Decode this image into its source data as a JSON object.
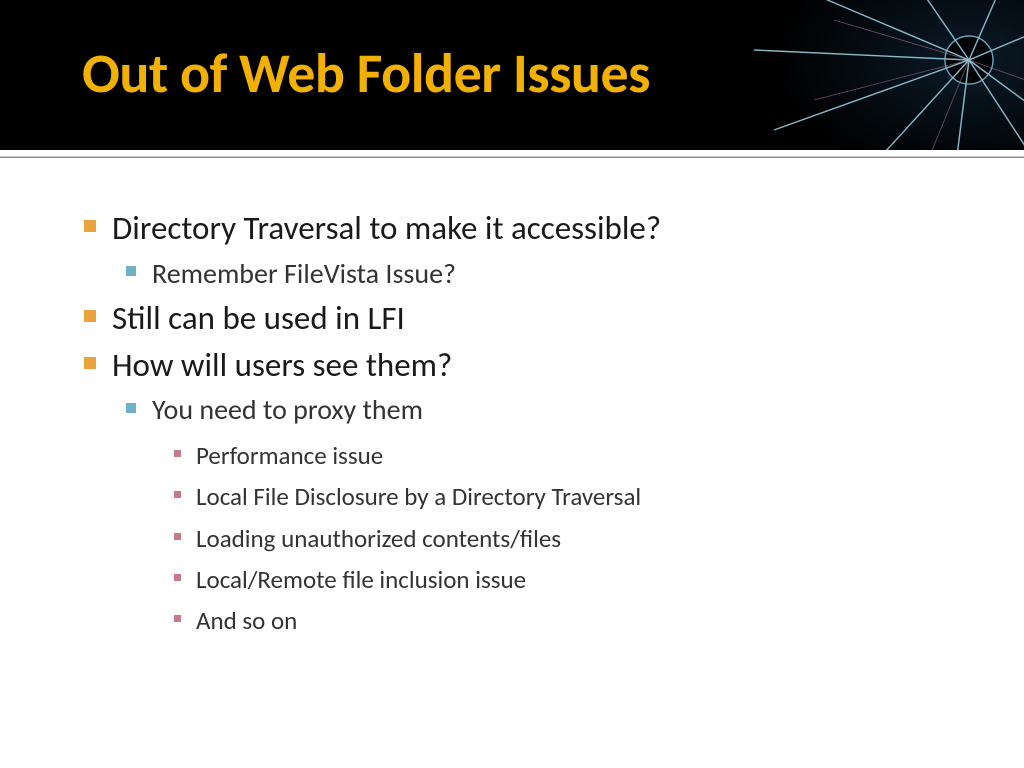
{
  "title": "Out of Web Folder Issues",
  "bullets": {
    "b1": "Directory Traversal to make it accessible?",
    "b1_1": "Remember FileVista Issue?",
    "b2": "Still can be used in LFI",
    "b3": "How will users see them?",
    "b3_1": "You need to proxy them",
    "b3_1_1": "Performance issue",
    "b3_1_2": "Local File Disclosure by a Directory Traversal",
    "b3_1_3": "Loading unauthorized contents/files",
    "b3_1_4": "Local/Remote file inclusion issue",
    "b3_1_5": "And so on"
  }
}
